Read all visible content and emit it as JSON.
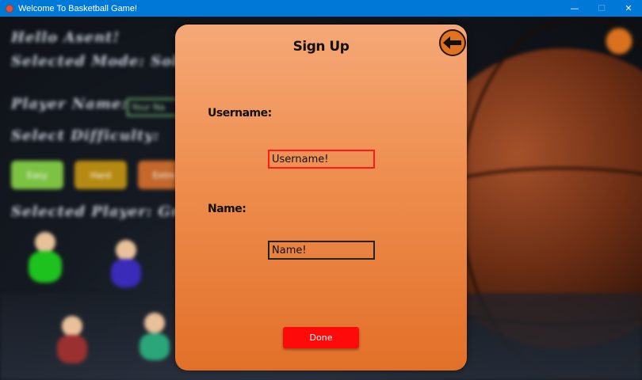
{
  "window": {
    "title": "Welcome To Basketball Game!",
    "controls": {
      "minimize": "—",
      "maximize": "☐",
      "close": "✕"
    }
  },
  "background": {
    "greeting": "Hello Asent!",
    "selected_mode": "Selected Mode: Solo",
    "player_name_label": "Player Name:",
    "player_name_input": "Your Na",
    "select_difficulty": "Select Difficulty:",
    "difficulty_buttons": [
      "Easy",
      "Hard",
      "Extre"
    ],
    "selected_player": "Selected Player: Green"
  },
  "dialog": {
    "title": "Sign Up",
    "back_icon": "arrow-left-icon",
    "username_label": "Username:",
    "username_placeholder": "Username!",
    "name_label": "Name:",
    "name_placeholder": "Name!",
    "done_label": "Done"
  },
  "colors": {
    "titlebar": "#0078d7",
    "dialog_top": "#f5a877",
    "dialog_bottom": "#e27029",
    "active_field_border": "#ff1a1a",
    "done_button": "#ff0a0a"
  }
}
